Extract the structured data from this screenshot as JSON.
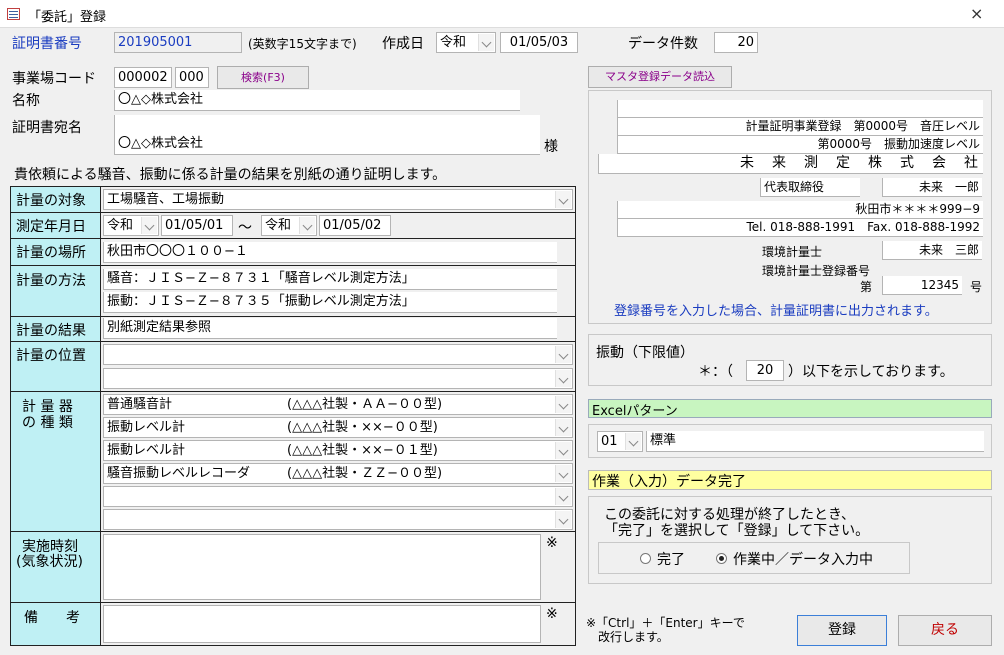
{
  "window": {
    "title": "「委託」登録",
    "close": "×"
  },
  "header": {
    "cert_no_label": "証明書番号",
    "cert_no_value": "201905001",
    "cert_no_hint": "(英数字15文字まで)",
    "created_label": "作成日",
    "era": "令和",
    "created_value": "01/05/03",
    "count_label": "データ件数",
    "count_value": "20"
  },
  "office": {
    "code_label": "事業場コード",
    "code1": "000002",
    "code2": "000",
    "search_button": "検索(F3)",
    "name_label": "名称",
    "name_value": "〇△◇株式会社",
    "addressee_label": "証明書宛名",
    "addressee_line1": "",
    "addressee_line2": "〇△◇株式会社",
    "sama": "様"
  },
  "statement": "貴依頼による騒音、振動に係る計量の結果を別紙の通り証明します。",
  "form": {
    "target_label": "計量の対象",
    "target_value": "工場騒音、工場振動",
    "date_label": "測定年月日",
    "date_era1": "令和",
    "date_from": "01/05/01",
    "tilde": "〜",
    "date_era2": "令和",
    "date_to": "01/05/02",
    "place_label": "計量の場所",
    "place_value": "秋田市〇〇〇１００−１",
    "method_label": "計量の方法",
    "method1": "騒音：ＪＩＳ−Ｚ−８７３１「騒音レベル測定方法」",
    "method2": "振動：ＪＩＳ−Ｚ−８７３５「振動レベル測定方法」",
    "result_label": "計量の結果",
    "result_value": "別紙測定結果参照",
    "position_label": "計量の位置",
    "instrument_label_1": "計 量 器",
    "instrument_label_2": "の 種 類",
    "instruments": [
      {
        "name": "普通騒音計",
        "model": "(△△△社製・ＡＡ−００型)"
      },
      {
        "name": "振動レベル計",
        "model": "(△△△社製・××−００型)"
      },
      {
        "name": "振動レベル計",
        "model": "(△△△社製・××−０１型)"
      },
      {
        "name": "騒音振動レベルレコーダ",
        "model": "(△△△社製・ＺＺ−００型)"
      }
    ],
    "time_label_1": "実施時刻",
    "time_label_2": "(気象状況)",
    "asterisk": "※",
    "remarks_label": "備　　考"
  },
  "master": {
    "button": "マスタ登録データ読込",
    "reg1": "計量証明事業登録　第0000号　音圧レベル",
    "reg2": "第0000号　振動加速度レベル",
    "company": "未　来　測　定　株　式　会　社",
    "rep_title": "代表取締役",
    "rep_name": "未来　一郎",
    "address": "秋田市＊＊＊＊999−9",
    "tel": "Tel. 018-888-1991　Fax. 018-888-1992",
    "meas_title": "環境計量士",
    "meas_name": "未来　三郎",
    "meas_reg_label": "環境計量士登録番号",
    "dai": "第",
    "meas_reg_no": "12345",
    "go": "号",
    "note": "登録番号を入力した場合、計量証明書に出力されます。"
  },
  "vibration": {
    "label": "振動（下限値）",
    "prefix": "＊：（",
    "value": "20",
    "suffix": "）以下を示しております。"
  },
  "excel": {
    "label": "Excelパターン",
    "code": "01",
    "name": "標準"
  },
  "work_status": "作業（入力）データ完了",
  "completion": {
    "msg1": "この委託に対する処理が終了したとき、",
    "msg2": "「完了」を選択して「登録」して下さい。",
    "opt1": "完了",
    "opt2": "作業中／データ入力中"
  },
  "footer": {
    "note1": "※「Ctrl」＋「Enter」キーで",
    "note2": "改行します。",
    "register": "登録",
    "back": "戻る"
  }
}
